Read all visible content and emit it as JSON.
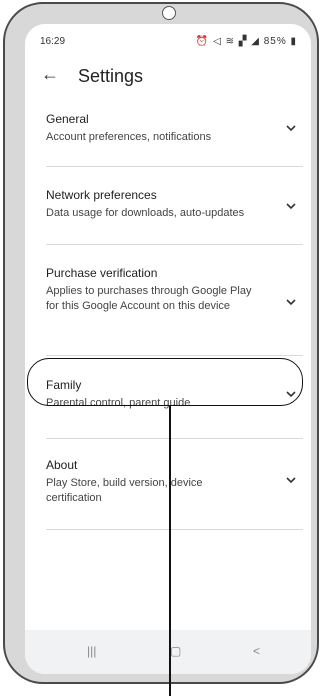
{
  "status_bar": {
    "time": "16:29",
    "icons": "⚙ ◀◀ ◢ ◥ 85%▮",
    "battery": "85%"
  },
  "app_bar": {
    "back_icon": "arrow-left-icon",
    "title": "Settings"
  },
  "settings_items": [
    {
      "title": "General",
      "subtitle": "Account preferences, notifications"
    },
    {
      "title": "Network preferences",
      "subtitle": "Data usage for downloads, auto-updates"
    },
    {
      "title": "Purchase verification",
      "subtitle": "Applies to purchases through Google Play for this Google Account on this device"
    },
    {
      "title": "Family",
      "subtitle": "Parental control, parent guide"
    },
    {
      "title": "About",
      "subtitle": "Play Store, build version, device certification"
    }
  ],
  "nav_bar": {
    "recents": "|||",
    "home": "▢",
    "back": "<"
  },
  "colors": {
    "frame": "#d8d8d8",
    "screen": "#ffffff",
    "divider": "#d9d9d9",
    "annotation": "#111111"
  }
}
